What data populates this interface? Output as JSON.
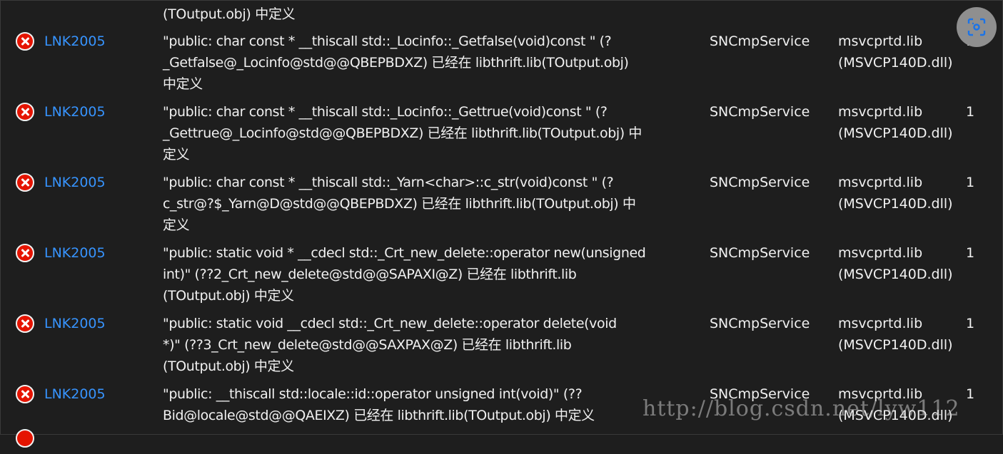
{
  "top_continuation": "(TOutput.obj) 中定义",
  "rows": [
    {
      "code": "LNK2005",
      "desc": [
        "\"public: char const * __thiscall std::_Locinfo::_Getfalse(void)const \" (?",
        "_Getfalse@_Locinfo@std@@QBEPBDXZ) 已经在 libthrift.lib(TOutput.obj)",
        "中定义"
      ],
      "project": "SNCmpService",
      "file": [
        "msvcprtd.lib",
        "(MSVCP140D.dll)"
      ],
      "line": "1"
    },
    {
      "code": "LNK2005",
      "desc": [
        "\"public: char const * __thiscall std::_Locinfo::_Gettrue(void)const \" (?",
        "_Gettrue@_Locinfo@std@@QBEPBDXZ) 已经在 libthrift.lib(TOutput.obj) 中",
        "定义"
      ],
      "project": "SNCmpService",
      "file": [
        "msvcprtd.lib",
        "(MSVCP140D.dll)"
      ],
      "line": "1"
    },
    {
      "code": "LNK2005",
      "desc": [
        "\"public: char const * __thiscall std::_Yarn<char>::c_str(void)const \" (?",
        "c_str@?$_Yarn@D@std@@QBEPBDXZ) 已经在 libthrift.lib(TOutput.obj) 中",
        "定义"
      ],
      "project": "SNCmpService",
      "file": [
        "msvcprtd.lib",
        "(MSVCP140D.dll)"
      ],
      "line": "1"
    },
    {
      "code": "LNK2005",
      "desc": [
        "\"public: static void * __cdecl std::_Crt_new_delete::operator new(unsigned",
        "int)\" (??2_Crt_new_delete@std@@SAPAXI@Z) 已经在 libthrift.lib",
        "(TOutput.obj) 中定义"
      ],
      "project": "SNCmpService",
      "file": [
        "msvcprtd.lib",
        "(MSVCP140D.dll)"
      ],
      "line": "1"
    },
    {
      "code": "LNK2005",
      "desc": [
        "\"public: static void __cdecl std::_Crt_new_delete::operator delete(void",
        "*)\" (??3_Crt_new_delete@std@@SAXPAX@Z) 已经在 libthrift.lib",
        "(TOutput.obj) 中定义"
      ],
      "project": "SNCmpService",
      "file": [
        "msvcprtd.lib",
        "(MSVCP140D.dll)"
      ],
      "line": "1"
    },
    {
      "code": "LNK2005",
      "desc": [
        "\"public: __thiscall std::locale::id::operator unsigned int(void)\" (??",
        "Bid@locale@std@@QAEIXZ) 已经在 libthrift.lib(TOutput.obj) 中定义"
      ],
      "project": "SNCmpService",
      "file": [
        "msvcprtd.lib",
        "(MSVCP140D.dll)"
      ],
      "line": "1"
    }
  ],
  "watermark": "http://blog.csdn.net/lyw112",
  "icons": {
    "row": "error-icon",
    "overlay": "screenshot-scan-icon"
  },
  "colors": {
    "error": "#e51400",
    "link": "#3794ff",
    "background": "#1e1e1e"
  }
}
